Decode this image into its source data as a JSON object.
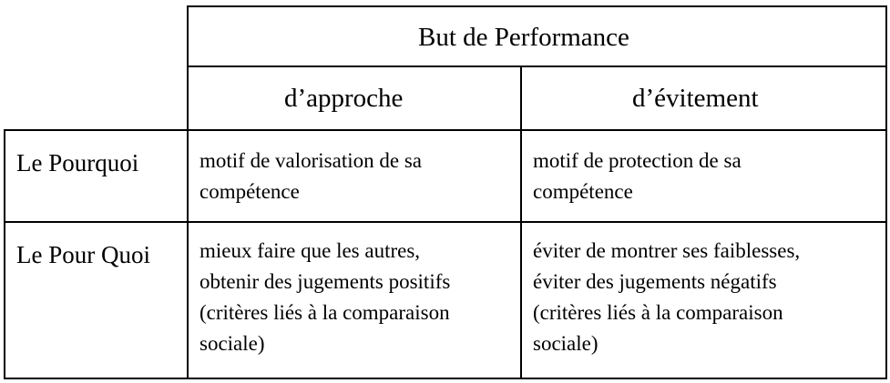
{
  "table": {
    "top_header": "But de Performance",
    "columns": [
      "d’approche",
      "d’évitement"
    ],
    "rows": [
      {
        "label": "Le Pourquoi",
        "cells": [
          "motif de valorisation de sa\ncompétence",
          "motif de protection de sa\ncompétence"
        ]
      },
      {
        "label": "Le Pour Quoi",
        "cells": [
          "mieux faire que les autres,\nobtenir des jugements positifs\n(critères liés à la comparaison\nsociale)",
          "éviter de montrer ses faiblesses,\néviter des jugements négatifs\n(critères liés à la comparaison\nsociale)"
        ]
      }
    ]
  }
}
